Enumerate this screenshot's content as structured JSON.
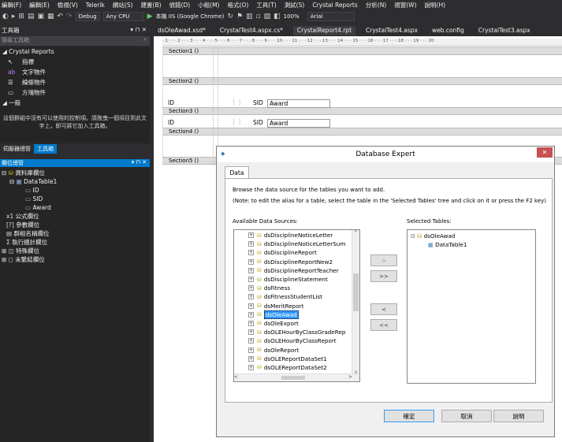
{
  "menu": [
    "編輯(F)",
    "編輯(E)",
    "檢視(V)",
    "Telerik",
    "網站(S)",
    "建置(B)",
    "偵錯(D)",
    "小組(M)",
    "格式(O)",
    "工具(T)",
    "測試(S)",
    "Crystal Reports",
    "分析(N)",
    "視窗(W)",
    "說明(H)"
  ],
  "toolbar": {
    "config": "Debug",
    "platform": "Any CPU",
    "run_label": "本機 IIS (Google Chrome)",
    "zoom": "100%",
    "font": "Arial"
  },
  "toolbox": {
    "title": "工具箱",
    "search_placeholder": "搜尋工具箱",
    "group": "Crystal Reports",
    "items": [
      "指標",
      "文字物件",
      "線條物件",
      "方塊物件"
    ],
    "general": "一般",
    "empty_text": "這個群組中沒有可以使用的控制項。請拖曳一個項目到此文字上，即可將它加入工具箱。"
  },
  "lower_tabs": [
    "伺服器總管",
    "工具箱"
  ],
  "field_explorer": {
    "title": "欄位總管",
    "items": [
      "資料庫欄位",
      "DataTable1",
      "ID",
      "SID",
      "Award",
      "公式欄位",
      "參數欄位",
      "群組名稱欄位",
      "執行總計欄位",
      "特殊欄位",
      "未繫結欄位"
    ]
  },
  "doc_tabs": [
    "dsOleAwad.xsd*",
    "CrystalTest4.aspx.cs*",
    "CrystalReport4.rpt",
    "CrystalTest4.aspx",
    "web.config",
    "CrystalTest3.aspx"
  ],
  "ruler": "· 1 · · · 2 · · · 3 · · · 4 · · · 5 · · · 6 · · · 7 · · · 8 · · · 9 · · · 10 · · · 11 · · · 12 · · · 13 · · · 14 · · · 15 · · · 16 · · · 17 · · · 18 · · · 19 · · · 20",
  "sections": [
    "Section1 ()",
    "Section2 ()",
    "Section3 ()",
    "Section4 ()",
    "Section5 ()"
  ],
  "report_fields": {
    "header": [
      "ID",
      "SID",
      "Award"
    ],
    "detail": [
      "ID",
      "SID",
      "Award"
    ]
  },
  "dialog": {
    "title": "Database Expert",
    "tab": "Data",
    "intro": "Browse the data source for the tables you want to add.",
    "note": "(Note: to edit the alias for a table, select the table in the 'Selected Tables' tree and click on it or press the F2 key)",
    "available_label": "Available Data Sources:",
    "selected_label": "Selected Tables:",
    "available": [
      "dsDisciplineNoticeLetter",
      "dsDisciplineNoticeLetterSum",
      "dsDisciplineReport",
      "dsDisciplineReportNew2",
      "dsDisciplineReportTeacher",
      "dsDisciplineStatement",
      "dsFitness",
      "dsFitnessStudentList",
      "dsMeritReport",
      "dsOleAwad",
      "dsOleExport",
      "dsOLEHourByClassGradeRep",
      "dsOLEHourByClassReport",
      "dsOleReport",
      "dsOLEReportDataSet1",
      "dsOLEReportDataSet2"
    ],
    "selected_index": 9,
    "selected_tree": [
      "dsOleAwad",
      "DataTable1"
    ],
    "move_buttons": [
      ">",
      ">>",
      "<",
      "<<"
    ],
    "ok": "確定",
    "cancel": "取消",
    "help": "說明"
  }
}
